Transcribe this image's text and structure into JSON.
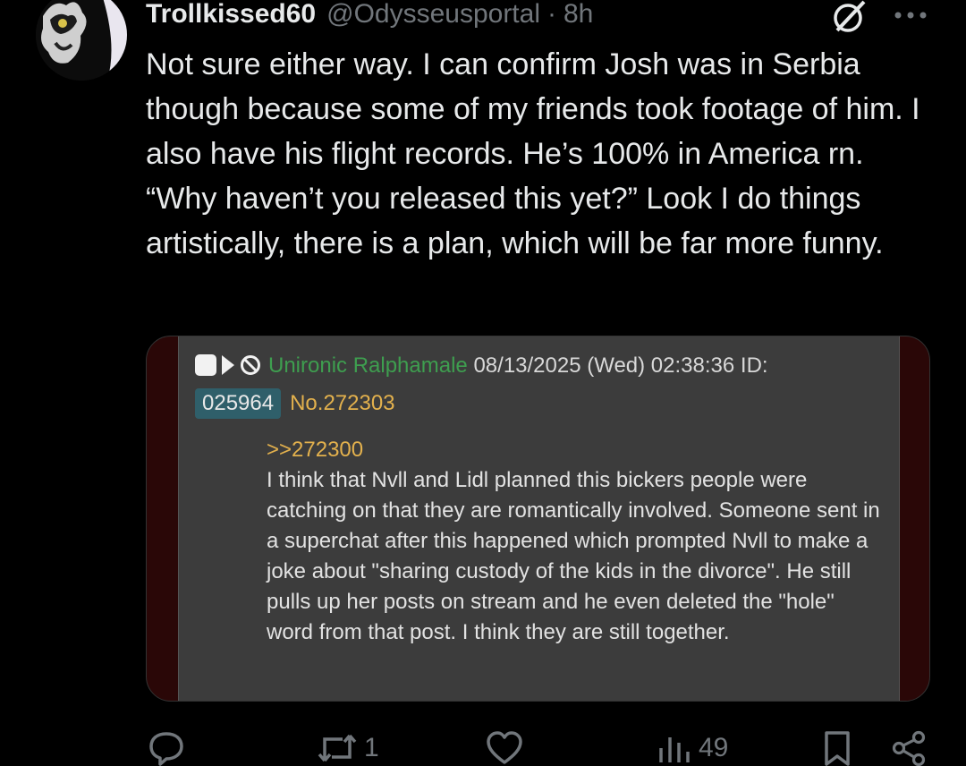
{
  "tweet": {
    "display_name": "Trollkissed60",
    "handle": "@Odysseusportal",
    "separator": "·",
    "time": "8h",
    "text": "Not sure either way. I can confirm Josh was in Serbia though because some of my friends took footage of him. I also have his flight records. He’s 100% in America rn. “Why haven’t you released this yet?” Look I do things artistically, there is a plan, which will be far more funny."
  },
  "embedded_post": {
    "poster_name": "Unironic Ralphamale",
    "datetime": "08/13/2025 (Wed) 02:38:36",
    "id_label": "ID:",
    "id_value": "025964",
    "post_number": "No.272303",
    "quote_link": ">>272300",
    "body": "I think that Nvll and Lidl planned this bickers people were catching on that they are romantically involved. Someone sent in a superchat after this happened which prompted Nvll to make a joke about \"sharing custody of the kids in the divorce\". He still pulls up her posts on stream and he even deleted the \"hole\" word from that post. I think they are still together.",
    "colors": {
      "poster": "#3e9e4f",
      "post_number": "#e3b14d",
      "id_badge": "#2f5f6a"
    }
  },
  "actions": {
    "reply_count": "",
    "retweet_count": "1",
    "like_count": "",
    "views_count": "49"
  },
  "icons": [
    "grok-icon",
    "more-icon",
    "reply-icon",
    "retweet-icon",
    "like-icon",
    "views-icon",
    "bookmark-icon",
    "share-icon"
  ]
}
